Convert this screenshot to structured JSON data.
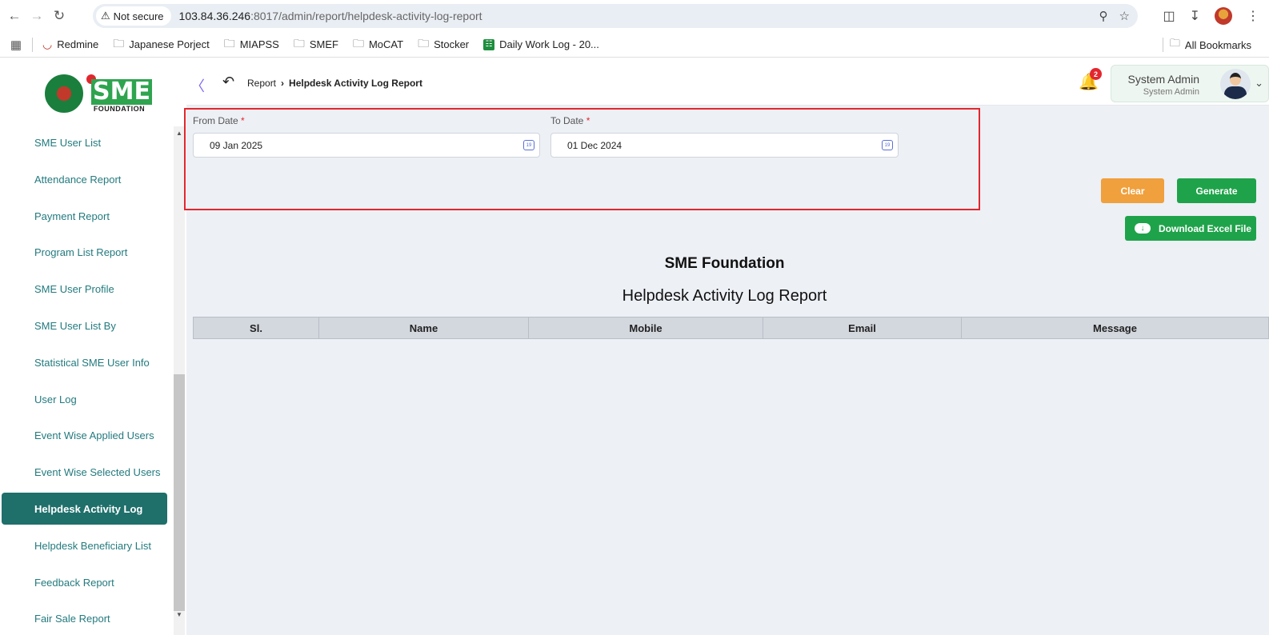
{
  "browser": {
    "security_label": "Not secure",
    "url_host": "103.84.36.246",
    "url_rest": ":8017/admin/report/helpdesk-activity-log-report",
    "bookmarks": [
      {
        "label": "Redmine",
        "icon": "redmine-icon"
      },
      {
        "label": "Japanese Porject",
        "icon": "folder-icon"
      },
      {
        "label": "MIAPSS",
        "icon": "folder-icon"
      },
      {
        "label": "SMEF",
        "icon": "folder-icon"
      },
      {
        "label": "MoCAT",
        "icon": "folder-icon"
      },
      {
        "label": "Stocker",
        "icon": "folder-icon"
      },
      {
        "label": "Daily Work Log - 20...",
        "icon": "sheets-icon"
      }
    ],
    "all_bookmarks": "All Bookmarks"
  },
  "header": {
    "breadcrumb_parent": "Report",
    "breadcrumb_current": "Helpdesk Activity Log Report",
    "notification_count": "2",
    "user_name": "System Admin",
    "user_role": "System Admin"
  },
  "logo": {
    "text": "SME",
    "subtext": "FOUNDATION"
  },
  "sidebar": {
    "items": [
      {
        "label": "SME User List",
        "active": false
      },
      {
        "label": "Attendance Report",
        "active": false
      },
      {
        "label": "Payment Report",
        "active": false
      },
      {
        "label": "Program List Report",
        "active": false
      },
      {
        "label": "SME User Profile",
        "active": false
      },
      {
        "label": "SME User List By",
        "active": false
      },
      {
        "label": "Statistical SME User Info",
        "active": false
      },
      {
        "label": "User Log",
        "active": false
      },
      {
        "label": "Event Wise Applied Users",
        "active": false
      },
      {
        "label": "Event Wise Selected Users",
        "active": false
      },
      {
        "label": "Helpdesk Activity Log",
        "active": true
      },
      {
        "label": "Helpdesk Beneficiary List",
        "active": false
      },
      {
        "label": "Feedback Report",
        "active": false
      },
      {
        "label": "Fair Sale Report",
        "active": false
      }
    ]
  },
  "filters": {
    "from_label": "From Date",
    "from_value": "09 Jan 2025",
    "to_label": "To Date",
    "to_value": "01 Dec 2024",
    "required_mark": "*"
  },
  "actions": {
    "clear": "Clear",
    "generate": "Generate",
    "download": "Download Excel File"
  },
  "report": {
    "org_title": "SME Foundation",
    "report_title": "Helpdesk Activity Log Report",
    "columns": [
      "Sl.",
      "Name",
      "Mobile",
      "Email",
      "Message"
    ]
  },
  "colors": {
    "sidebar_active": "#1f6f6b",
    "sidebar_text": "#237a7e",
    "clear_btn": "#f0a03c",
    "generate_btn": "#1fa34a",
    "highlight_border": "#e3262e"
  }
}
